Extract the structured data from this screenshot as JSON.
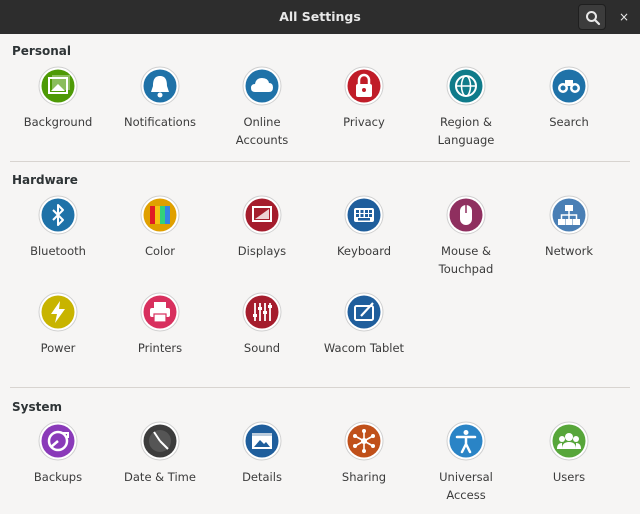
{
  "window": {
    "title": "All Settings",
    "close_glyph": "×",
    "search_icon": "search-icon"
  },
  "sections": [
    {
      "title": "Personal",
      "items": [
        {
          "label": "Background",
          "icon": "background-icon",
          "color": "#4e9a06"
        },
        {
          "label": "Notifications",
          "icon": "notifications-icon",
          "color": "#1f72a8"
        },
        {
          "label": "Online\nAccounts",
          "icon": "online-accounts-icon",
          "color": "#1f72a8"
        },
        {
          "label": "Privacy",
          "icon": "privacy-icon",
          "color": "#c01c28"
        },
        {
          "label": "Region &\nLanguage",
          "icon": "region-language-icon",
          "color": "#0f7b8a"
        },
        {
          "label": "Search",
          "icon": "search-settings-icon",
          "color": "#1f72a8"
        }
      ]
    },
    {
      "title": "Hardware",
      "items": [
        {
          "label": "Bluetooth",
          "icon": "bluetooth-icon",
          "color": "#1f72a8"
        },
        {
          "label": "Color",
          "icon": "color-icon",
          "color": "#e0a000"
        },
        {
          "label": "Displays",
          "icon": "displays-icon",
          "color": "#a51d2d"
        },
        {
          "label": "Keyboard",
          "icon": "keyboard-icon",
          "color": "#1f5e9c"
        },
        {
          "label": "Mouse &\nTouchpad",
          "icon": "mouse-icon",
          "color": "#8f2f5f"
        },
        {
          "label": "Network",
          "icon": "network-icon",
          "color": "#4a7fb5"
        },
        {
          "label": "Power",
          "icon": "power-icon",
          "color": "#c8b400"
        },
        {
          "label": "Printers",
          "icon": "printers-icon",
          "color": "#d8305e"
        },
        {
          "label": "Sound",
          "icon": "sound-icon",
          "color": "#a51d2d"
        },
        {
          "label": "Wacom Tablet",
          "icon": "wacom-tablet-icon",
          "color": "#1f5e9c"
        }
      ]
    },
    {
      "title": "System",
      "items": [
        {
          "label": "Backups",
          "icon": "backups-icon",
          "color": "#8a3ab9"
        },
        {
          "label": "Date & Time",
          "icon": "date-time-icon",
          "color": "#3c3c3c"
        },
        {
          "label": "Details",
          "icon": "details-icon",
          "color": "#1f5e9c"
        },
        {
          "label": "Sharing",
          "icon": "sharing-icon",
          "color": "#c0501a"
        },
        {
          "label": "Universal\nAccess",
          "icon": "universal-access-icon",
          "color": "#2a84c6"
        },
        {
          "label": "Users",
          "icon": "users-icon",
          "color": "#57a63a"
        }
      ]
    }
  ]
}
